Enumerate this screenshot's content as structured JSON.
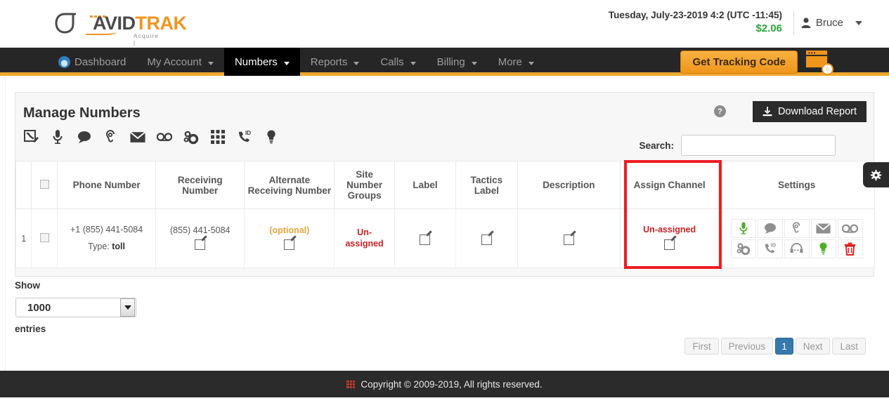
{
  "header": {
    "logo_text_dark": "AVID",
    "logo_text_accent": "TRAK",
    "logo_tagline": "Acquire  |  Analyze  |  Act",
    "datetime": "Tuesday, July-23-2019 4:2 (UTC -11:45)",
    "balance": "$2.06",
    "user_name": "Bruce",
    "user_icon": "user-icon",
    "caret_icon": "chevron-down-icon"
  },
  "nav": {
    "items": [
      {
        "label": "Dashboard",
        "icon": "dashboard-icon",
        "has_caret": false,
        "active": false
      },
      {
        "label": "My Account",
        "icon": "",
        "has_caret": true,
        "active": false
      },
      {
        "label": "Numbers",
        "icon": "",
        "has_caret": true,
        "active": true
      },
      {
        "label": "Reports",
        "icon": "",
        "has_caret": true,
        "active": false
      },
      {
        "label": "Calls",
        "icon": "",
        "has_caret": true,
        "active": false
      },
      {
        "label": "Billing",
        "icon": "",
        "has_caret": true,
        "active": false
      },
      {
        "label": "More",
        "icon": "",
        "has_caret": true,
        "active": false
      }
    ],
    "get_tracking_code": "Get Tracking Code",
    "tracking_icon": "browser-window-home-icon"
  },
  "card": {
    "title": "Manage Numbers",
    "help_icon": "help-question-icon",
    "help_label": "?",
    "download_label": "Download Report",
    "download_icon": "download-icon",
    "toolbar_icons": [
      "phone-edit-icon",
      "microphone-icon",
      "chat-bubble-icon",
      "ear-whisper-icon",
      "envelope-icon",
      "voicemail-icon",
      "gears-icon",
      "keypad-icon",
      "caller-id-icon",
      "lightbulb-icon"
    ],
    "search_label": "Search:",
    "search_value": "",
    "search_placeholder": ""
  },
  "table": {
    "columns": [
      "",
      "",
      "Phone Number",
      "Receiving Number",
      "Alternate Receiving Number",
      "Site Number Groups",
      "Label",
      "Tactics Label",
      "Description",
      "Assign Channel",
      "Settings"
    ],
    "rows": [
      {
        "index": "1",
        "phone_number": "+1 (855) 441-5084",
        "type_label": "Type:",
        "type_value": "toll",
        "receiving_number": "(855) 441-5084",
        "alternate_receiving_number": "(optional)",
        "site_number_groups": "Un-assigned",
        "label": "",
        "tactics_label": "",
        "description": "",
        "assign_channel": "Un-assigned",
        "edit_icon": "edit-pencil-icon",
        "settings_icons": [
          "microphone-icon",
          "chat-bubble-icon",
          "ear-whisper-icon",
          "envelope-icon",
          "voicemail-icon",
          "gears-icon",
          "caller-id-icon",
          "headset-icon",
          "lightbulb-icon",
          "trash-icon"
        ]
      }
    ],
    "settings_gear_tab_icon": "gear-icon"
  },
  "paging": {
    "show_label": "Show",
    "page_size": "1000",
    "entries_label": "entries",
    "buttons": [
      "First",
      "Previous",
      "1",
      "Next",
      "Last"
    ],
    "active_page": "1"
  },
  "footer": {
    "icon": "grid-logo-icon",
    "text": "Copyright © 2009-2019, All rights reserved."
  },
  "colors": {
    "nav_bg": "#262626",
    "accent_orange": "#f0a830",
    "balance_green": "#2aa83d",
    "highlight_red": "#ee1c24",
    "unassigned_red": "#d02020",
    "optional_orange": "#e8a33d",
    "page_active_blue": "#3579ad"
  }
}
